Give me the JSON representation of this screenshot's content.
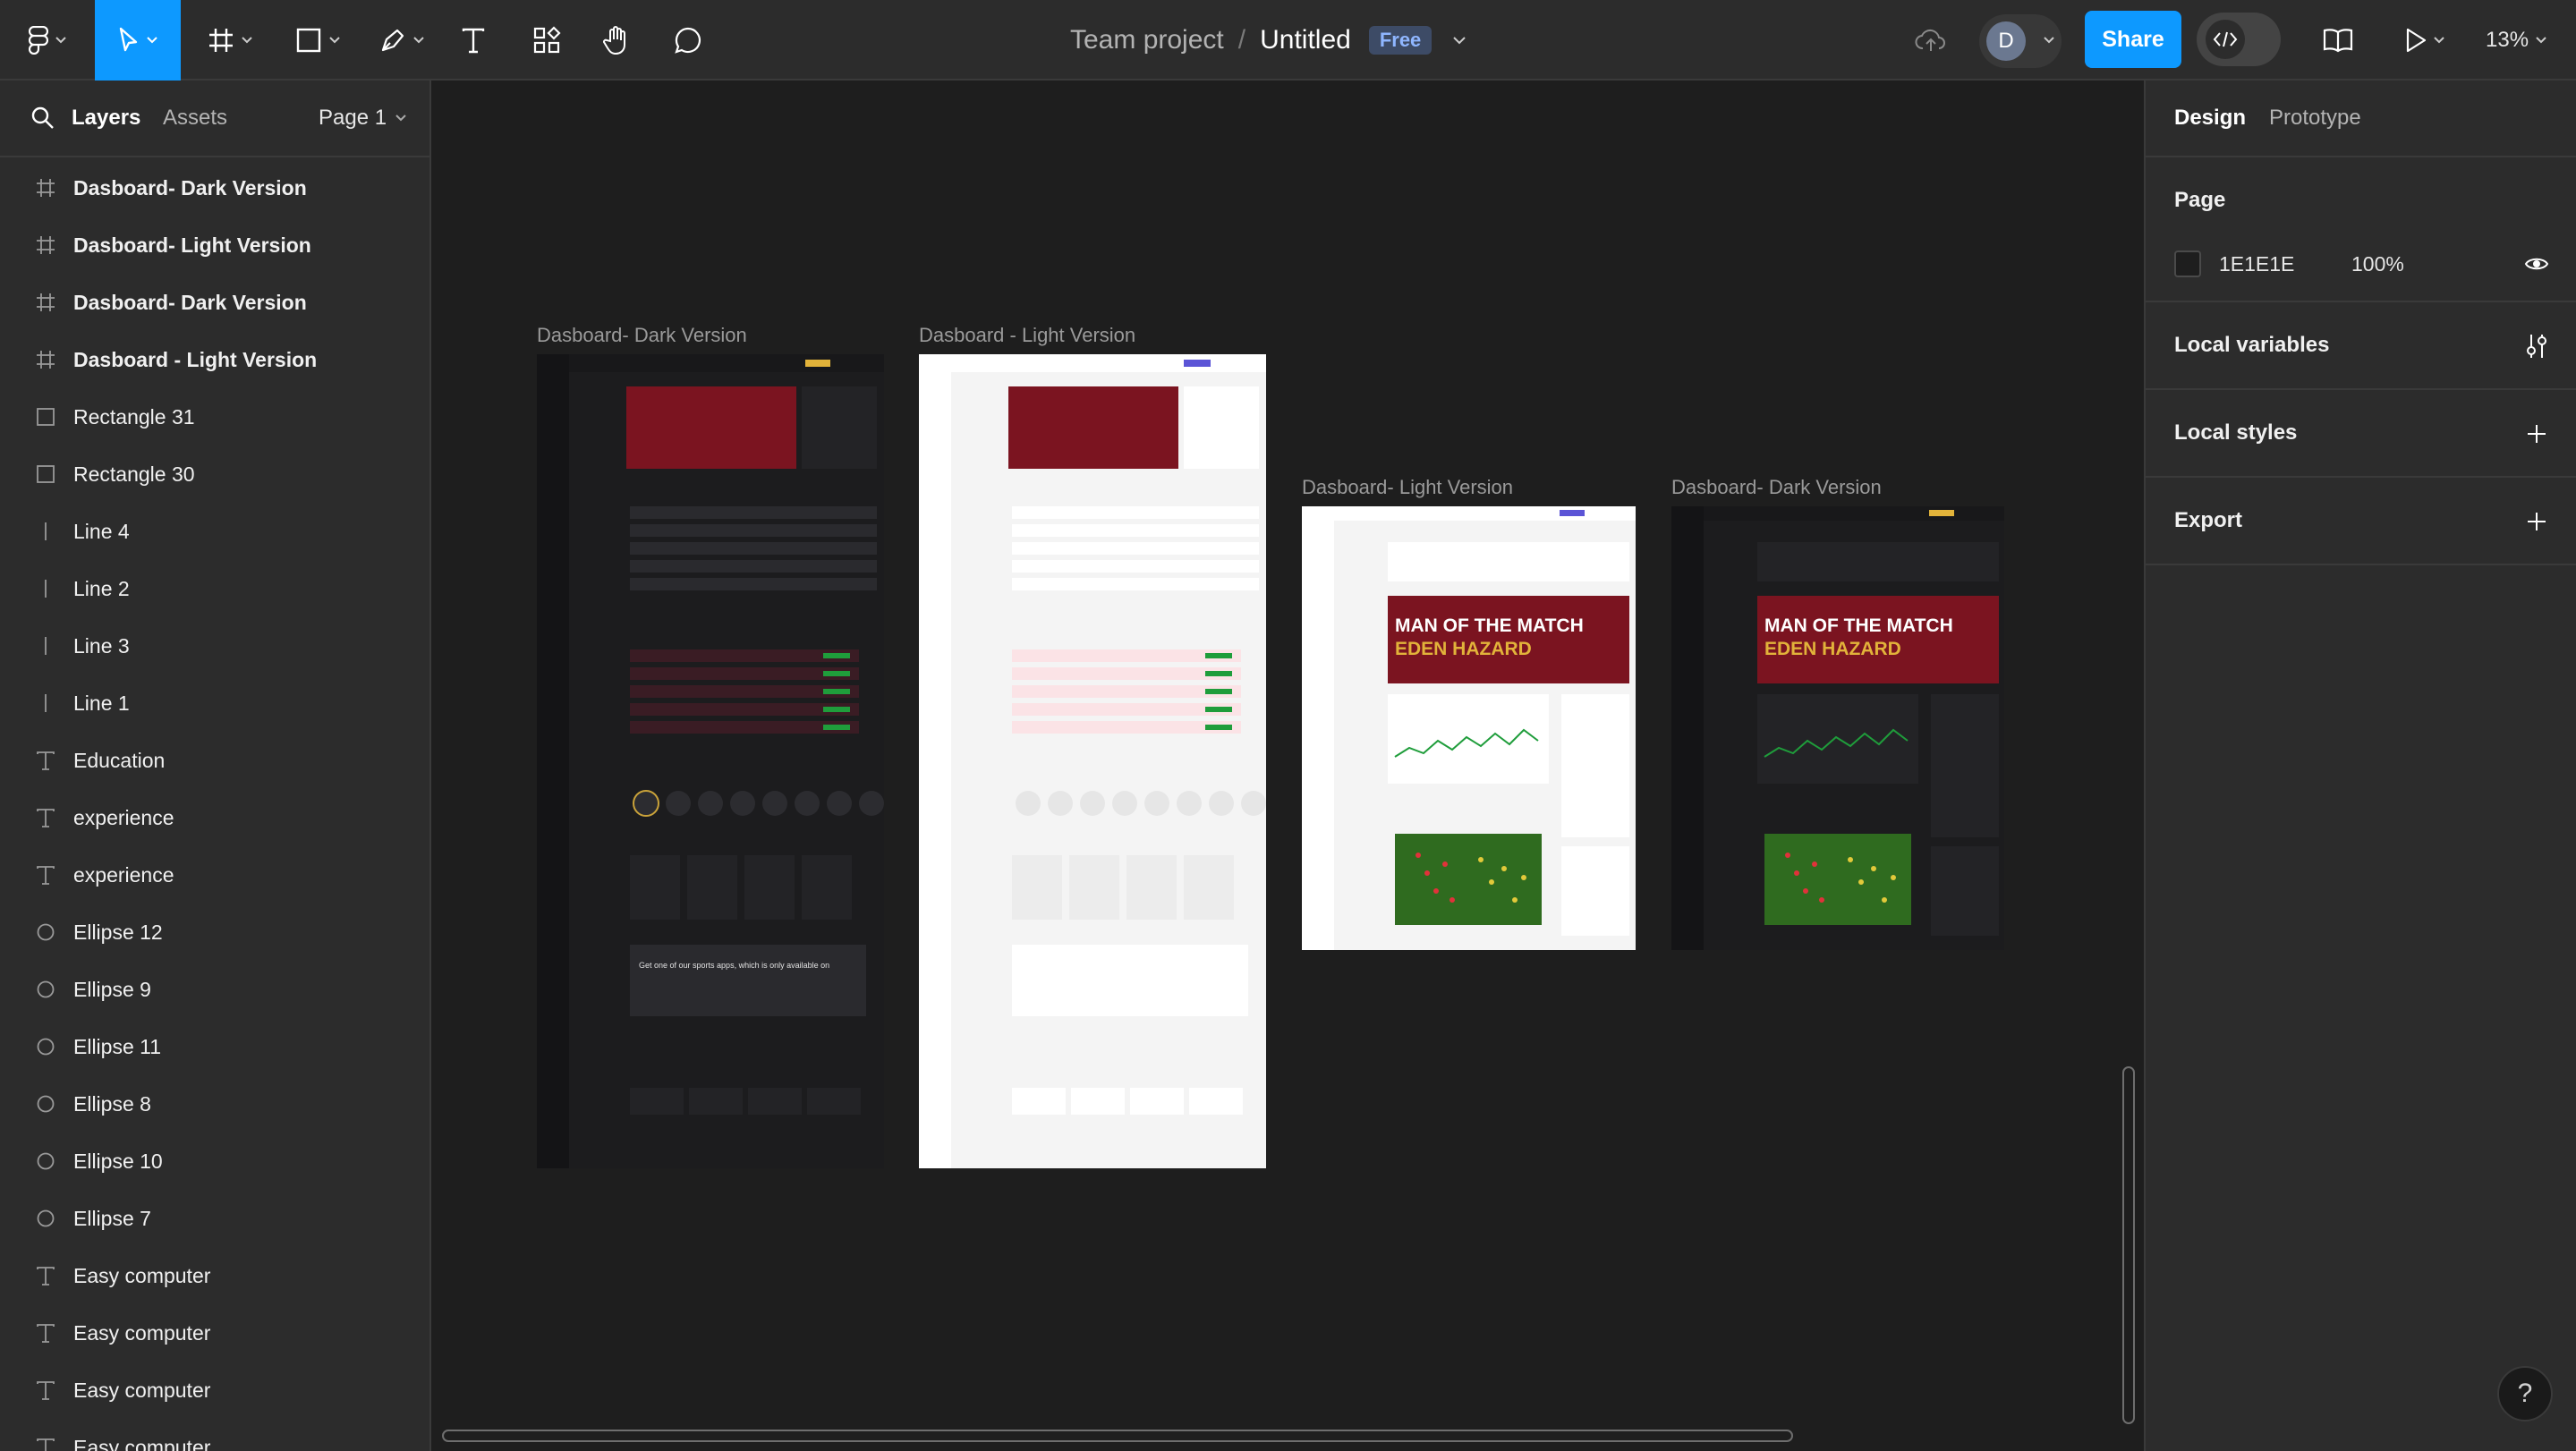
{
  "toolbar": {
    "doc_team": "Team project",
    "doc_separator": "/",
    "doc_title": "Untitled",
    "plan_badge": "Free",
    "share_label": "Share",
    "avatar_initial": "D",
    "zoom_level": "13%",
    "tools": [
      "main-menu",
      "move",
      "frame",
      "shape",
      "pen",
      "text",
      "resources",
      "hand",
      "comment"
    ],
    "active_tool": "move"
  },
  "left_panel": {
    "tabs": [
      "Layers",
      "Assets"
    ],
    "active_tab": "Layers",
    "page_label": "Page 1",
    "layers": [
      {
        "name": "Dasboard- Dark Version",
        "type": "frame"
      },
      {
        "name": "Dasboard- Light Version",
        "type": "frame"
      },
      {
        "name": "Dasboard- Dark Version",
        "type": "frame"
      },
      {
        "name": "Dasboard - Light Version",
        "type": "frame"
      },
      {
        "name": "Rectangle 31",
        "type": "rectangle"
      },
      {
        "name": "Rectangle 30",
        "type": "rectangle"
      },
      {
        "name": "Line 4",
        "type": "line"
      },
      {
        "name": "Line 2",
        "type": "line"
      },
      {
        "name": "Line 3",
        "type": "line"
      },
      {
        "name": "Line 1",
        "type": "line"
      },
      {
        "name": "Education",
        "type": "text"
      },
      {
        "name": "experience",
        "type": "text"
      },
      {
        "name": "experience",
        "type": "text"
      },
      {
        "name": "Ellipse 12",
        "type": "ellipse"
      },
      {
        "name": "Ellipse 9",
        "type": "ellipse"
      },
      {
        "name": "Ellipse 11",
        "type": "ellipse"
      },
      {
        "name": "Ellipse 8",
        "type": "ellipse"
      },
      {
        "name": "Ellipse 10",
        "type": "ellipse"
      },
      {
        "name": "Ellipse 7",
        "type": "ellipse"
      },
      {
        "name": "Easy computer",
        "type": "text"
      },
      {
        "name": "Easy computer",
        "type": "text"
      },
      {
        "name": "Easy computer",
        "type": "text"
      },
      {
        "name": "Easy computer",
        "type": "text"
      }
    ]
  },
  "canvas": {
    "frames": [
      {
        "label": "Dasboard- Dark Version",
        "theme": "dark"
      },
      {
        "label": "Dasboard - Light Version",
        "theme": "light"
      },
      {
        "label": "Dasboard- Light Version",
        "theme": "light"
      },
      {
        "label": "Dasboard- Dark Version",
        "theme": "dark"
      }
    ],
    "hero_line1": "MAN OF THE MATCH",
    "hero_line2": "EDEN HAZARD",
    "promo_text": "Get one of our sports apps, which is only available on"
  },
  "right_panel": {
    "tabs": [
      "Design",
      "Prototype"
    ],
    "active_tab": "Design",
    "page_section": "Page",
    "page_color": "1E1E1E",
    "page_opacity": "100%",
    "local_variables": "Local variables",
    "local_styles": "Local styles",
    "export": "Export"
  },
  "help_label": "?",
  "colors": {
    "accent": "#0d99ff",
    "hero_red": "#7b1420",
    "pitch_green": "#2f6b1f"
  }
}
